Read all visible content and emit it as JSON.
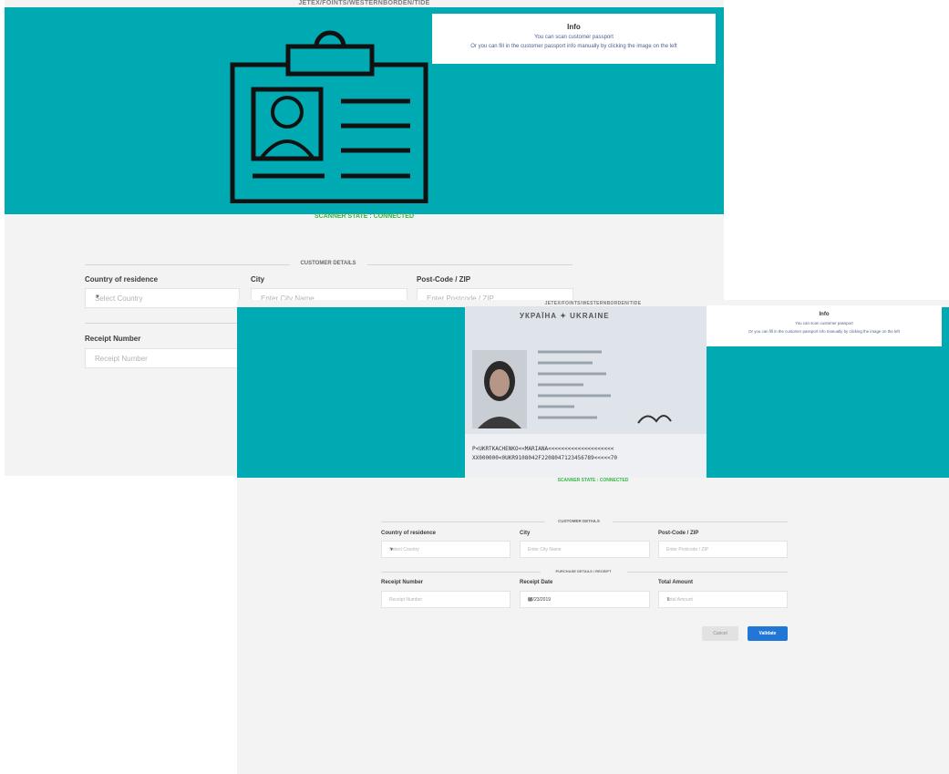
{
  "back": {
    "breadcrumb": "JETEX/FOINTS/WESTERNBORDEN/TIDE",
    "info": {
      "title": "Info",
      "line1": "You can scan customer passport",
      "line2": "Or you can fill in the customer passport info manually by clicking the image on the left"
    },
    "scanner_state": "SCANNER STATE : CONNECTED",
    "customer_details_title": "CUSTOMER DETAILS",
    "country_label": "Country of residence",
    "country_placeholder": "Select Country",
    "city_label": "City",
    "city_placeholder": "Enter City Name",
    "postcode_label": "Post-Code / ZIP",
    "postcode_placeholder": "Enter Postcode / ZIP",
    "receipt_number_label": "Receipt Number",
    "receipt_number_placeholder": "Receipt Number"
  },
  "front": {
    "breadcrumb": "JETEX/FOINTS/WESTERNBORDEN/TIDE",
    "info": {
      "title": "Info",
      "line1": "You can scan customer passport",
      "line2": "Or you can fill in the customer passport info manually by clicking the image on the left"
    },
    "passport": {
      "header": "УКРАЇНА ✦ UKRAINE",
      "mrz_line1": "P<UKRTKACHENKO<<MARIANA<<<<<<<<<<<<<<<<<<<<",
      "mrz_line2": "XX000000<0UKR9108042F2208047123456789<<<<<70"
    },
    "scanner_state": "SCANNER STATE : CONNECTED",
    "customer_details_title": "CUSTOMER DETAILS",
    "country_label": "Country of residence",
    "country_placeholder": "Select Country",
    "city_label": "City",
    "city_placeholder": "Enter City Name",
    "postcode_label": "Post-Code / ZIP",
    "postcode_placeholder": "Enter Postcode / ZIP",
    "purchase_details_title": "PURCHASE DETAILS / RECEIPT",
    "receipt_number_label": "Receipt Number",
    "receipt_number_placeholder": "Receipt Number",
    "receipt_date_label": "Receipt Date",
    "receipt_date_value": "08/23/2019",
    "total_amount_label": "Total Amount",
    "total_amount_placeholder": "Total Amount",
    "cancel_label": "Cancel",
    "validate_label": "Validate"
  },
  "colors": {
    "teal": "#00aab2",
    "scanner_green": "#39b54a",
    "validate_blue": "#2277d6"
  },
  "icons": [
    "id-badge-icon",
    "calendar-icon",
    "chevron-down-icon",
    "spinner-icon"
  ]
}
